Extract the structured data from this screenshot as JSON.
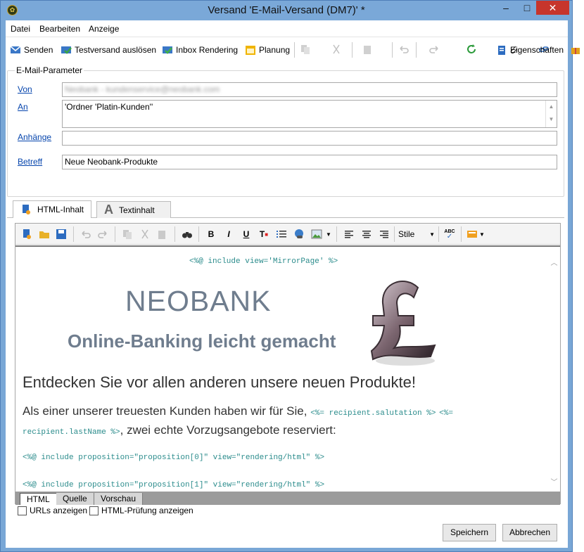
{
  "window": {
    "title": "Versand 'E-Mail-Versand (DM7)' *"
  },
  "menu": {
    "file": "Datei",
    "edit": "Bearbeiten",
    "view": "Anzeige"
  },
  "toolbar": {
    "send": "Senden",
    "test": "Testversand auslösen",
    "inbox": "Inbox Rendering",
    "plan": "Planung",
    "props": "Eigenschaften"
  },
  "params": {
    "legend": "E-Mail-Parameter",
    "from_label": "Von",
    "from_value": "Neobank - kundenservice@neobank.com",
    "to_label": "An",
    "to_value": "'Ordner 'Platin-Kunden''",
    "attach_label": "Anhänge",
    "attach_value": "",
    "subject_label": "Betreff",
    "subject_value": "Neue Neobank-Produkte"
  },
  "tabs": {
    "html": "HTML-Inhalt",
    "text": "Textinhalt"
  },
  "editor": {
    "style_label": "Stile"
  },
  "content": {
    "mirror": "<%@ include view='MirrorPage' %>",
    "brand": "NEOBANK",
    "slogan": "Online-Banking leicht gemacht",
    "headline": "Entdecken Sie vor allen anderen unsere neuen Produkte!",
    "intro": "Als einer unserer treuesten Kunden haben wir für Sie,",
    "salutation": "<%= recipient.salutation %>",
    "lastname_a": "<%=",
    "lastname_b": "recipient.lastName %>",
    "intro_end": ", zwei echte Vorzugsangebote reserviert:",
    "prop0": "<%@ include proposition=\"proposition[0]\" view=\"rendering/html\" %>",
    "prop1": "<%@ include proposition=\"proposition[1]\" view=\"rendering/html\" %>"
  },
  "bottom_tabs": {
    "html": "HTML",
    "source": "Quelle",
    "preview": "Vorschau"
  },
  "options": {
    "urls": "URLs anzeigen",
    "check": "HTML-Prüfung anzeigen"
  },
  "buttons": {
    "save": "Speichern",
    "cancel": "Abbrechen"
  }
}
